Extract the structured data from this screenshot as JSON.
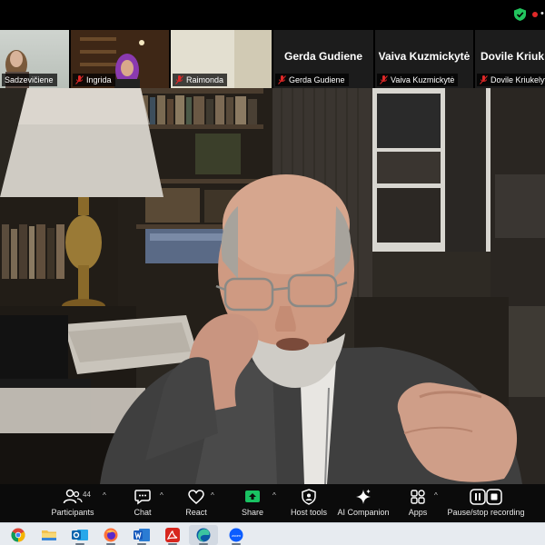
{
  "gallery": {
    "tiles": [
      {
        "name": "Sadzevičiene",
        "has_video": true
      },
      {
        "name": "Ingrida",
        "has_video": true
      },
      {
        "name": "Raimonda",
        "has_video": true
      },
      {
        "name": "Gerda Gudiene",
        "display": "Gerda Gudiene",
        "has_video": false
      },
      {
        "name": "Vaiva Kuzmickytė",
        "display": "Vaiva Kuzmickytė",
        "has_video": false
      },
      {
        "name": "Dovile Kriukelyt",
        "display": "Dovile Kriuk",
        "has_video": false
      }
    ]
  },
  "toolbar": {
    "participants_label": "Participants",
    "participants_count": "44",
    "chat_label": "Chat",
    "react_label": "React",
    "share_label": "Share",
    "host_tools_label": "Host tools",
    "ai_companion_label": "AI Companion",
    "apps_label": "Apps",
    "recording_label": "Pause/stop recording"
  },
  "taskbar": {
    "apps": [
      "chrome-icon",
      "file-explorer-icon",
      "outlook-icon",
      "firefox-icon",
      "word-icon",
      "acrobat-icon",
      "edge-icon",
      "zoom-icon"
    ]
  },
  "colors": {
    "share_green": "#19c262",
    "mic_off_red": "#e02828",
    "secure_green": "#22c55e"
  }
}
